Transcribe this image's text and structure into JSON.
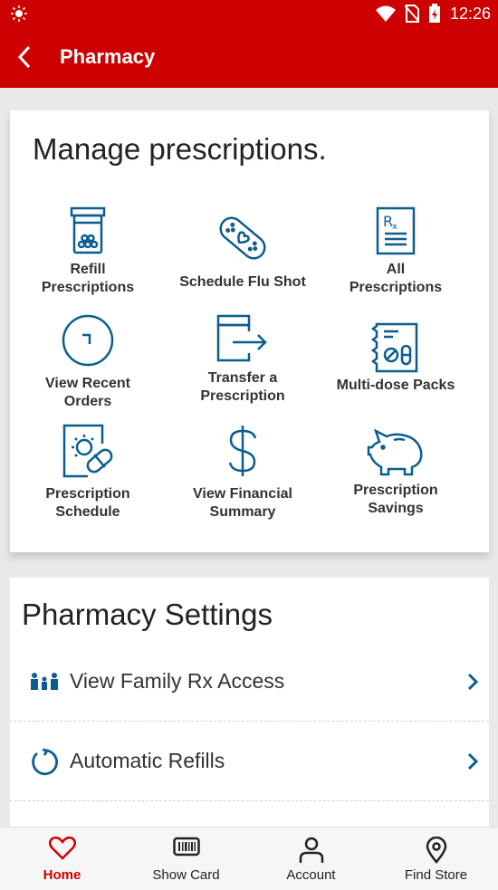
{
  "status_bar": {
    "time": "12:26"
  },
  "app_bar": {
    "title": "Pharmacy"
  },
  "manage": {
    "heading": "Manage prescriptions.",
    "tiles": [
      {
        "label_line1": "Refill",
        "label_line2": "Prescriptions",
        "icon": "pill-bottle-icon"
      },
      {
        "label_line1": "Schedule Flu Shot",
        "label_line2": "",
        "icon": "bandage-icon"
      },
      {
        "label_line1": "All",
        "label_line2": "Prescriptions",
        "icon": "rx-document-icon"
      },
      {
        "label_line1": "View Recent",
        "label_line2": "Orders",
        "icon": "clock-icon"
      },
      {
        "label_line1": "Transfer a",
        "label_line2": "Prescription",
        "icon": "transfer-bottle-icon"
      },
      {
        "label_line1": "Multi-dose Packs",
        "label_line2": "",
        "icon": "multi-dose-pack-icon"
      },
      {
        "label_line1": "Prescription",
        "label_line2": "Schedule",
        "icon": "sun-pill-calendar-icon"
      },
      {
        "label_line1": "View Financial",
        "label_line2": "Summary",
        "icon": "dollar-icon"
      },
      {
        "label_line1": "Prescription",
        "label_line2": "Savings",
        "icon": "piggy-bank-icon"
      }
    ]
  },
  "settings": {
    "heading": "Pharmacy Settings",
    "rows": [
      {
        "label": "View Family Rx Access",
        "icon": "family-icon"
      },
      {
        "label": "Automatic Refills",
        "icon": "refresh-icon"
      }
    ]
  },
  "bottom_nav": [
    {
      "label": "Home",
      "icon": "heart-icon",
      "active": true
    },
    {
      "label": "Show Card",
      "icon": "barcode-card-icon",
      "active": false
    },
    {
      "label": "Account",
      "icon": "person-icon",
      "active": false
    },
    {
      "label": "Find Store",
      "icon": "location-pin-icon",
      "active": false
    }
  ],
  "colors": {
    "brand": "#cc0000",
    "icon_blue": "#0a5e8f",
    "text": "#333333"
  }
}
